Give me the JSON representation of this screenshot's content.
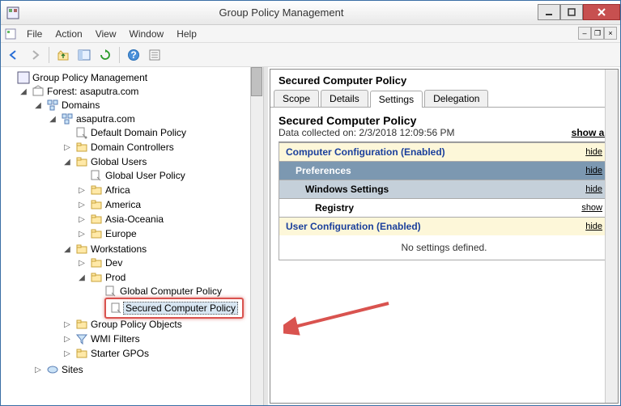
{
  "window": {
    "title": "Group Policy Management"
  },
  "menu": {
    "file": "File",
    "action": "Action",
    "view": "View",
    "window": "Window",
    "help": "Help"
  },
  "tree": {
    "root": "Group Policy Management",
    "forest": "Forest: asaputra.com",
    "domains": "Domains",
    "domain": "asaputra.com",
    "default_policy": "Default Domain Policy",
    "domain_controllers": "Domain Controllers",
    "global_users": "Global Users",
    "global_user_policy": "Global User Policy",
    "africa": "Africa",
    "america": "America",
    "asia": "Asia-Oceania",
    "europe": "Europe",
    "workstations": "Workstations",
    "dev": "Dev",
    "prod": "Prod",
    "global_comp_policy": "Global Computer Policy",
    "secured_comp_policy": "Secured Computer Policy",
    "gpo": "Group Policy Objects",
    "wmi": "WMI Filters",
    "starter": "Starter GPOs",
    "sites": "Sites"
  },
  "detail": {
    "title": "Secured Computer Policy",
    "tabs": {
      "scope": "Scope",
      "details": "Details",
      "settings": "Settings",
      "delegation": "Delegation"
    },
    "header": "Secured Computer Policy",
    "collected_label": "Data collected on: ",
    "collected_date": "2/3/2018 12:09:56 PM",
    "show_all": "show all",
    "comp_conf": "Computer Configuration (Enabled)",
    "preferences": "Preferences",
    "win_settings": "Windows Settings",
    "registry": "Registry",
    "user_conf": "User Configuration (Enabled)",
    "no_settings": "No settings defined.",
    "hide": "hide",
    "show": "show"
  }
}
